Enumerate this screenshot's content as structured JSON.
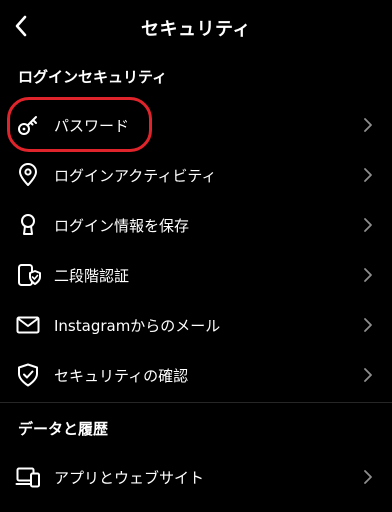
{
  "header": {
    "title": "セキュリティ",
    "back_icon": "chevron-left-icon"
  },
  "sections": {
    "login_security": {
      "title": "ログインセキュリティ",
      "items": [
        {
          "label": "パスワード",
          "icon": "key-icon",
          "highlighted": true
        },
        {
          "label": "ログインアクティビティ",
          "icon": "location-pin-icon"
        },
        {
          "label": "ログイン情報を保存",
          "icon": "keyhole-icon"
        },
        {
          "label": "二段階認証",
          "icon": "shield-phone-icon"
        },
        {
          "label": "Instagramからのメール",
          "icon": "mail-icon"
        },
        {
          "label": "セキュリティの確認",
          "icon": "shield-check-icon"
        }
      ]
    },
    "data_history": {
      "title": "データと履歴",
      "items": [
        {
          "label": "アプリとウェブサイト",
          "icon": "devices-icon"
        }
      ]
    }
  },
  "colors": {
    "background": "#000000",
    "text": "#ffffff",
    "divider": "#262626",
    "highlight": "#e0242b",
    "chevron": "#8e8e8e"
  }
}
